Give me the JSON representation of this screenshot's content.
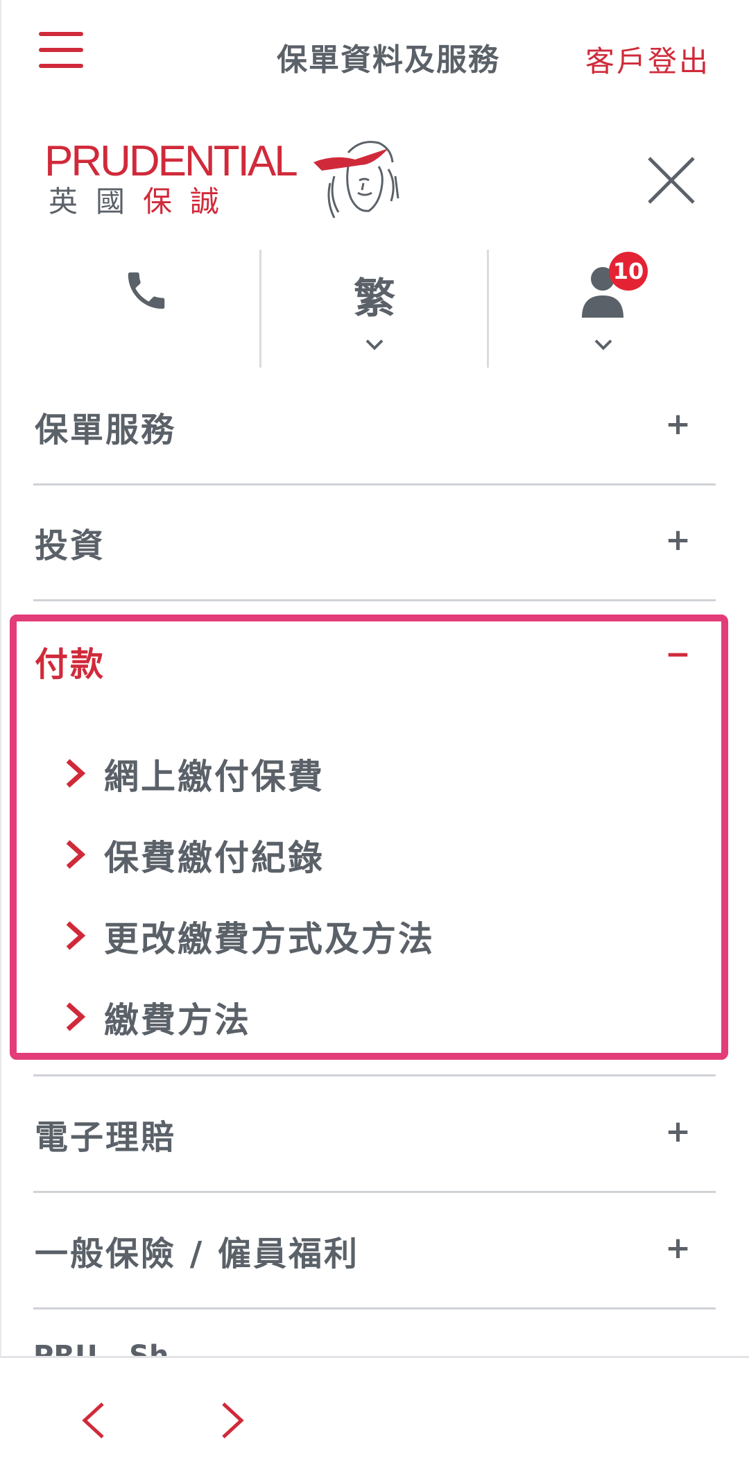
{
  "header": {
    "title": "保單資料及服務",
    "logout_label": "客戶登出"
  },
  "logo": {
    "brand_en": "PRUDENTIAL",
    "brand_cn_grey": "英國",
    "brand_cn_red": "保誠"
  },
  "utility": {
    "language_label": "繁",
    "notification_count": "10"
  },
  "menu": {
    "sections": [
      {
        "label": "保單服務",
        "toggle": "+"
      },
      {
        "label": "投資",
        "toggle": "+"
      },
      {
        "label": "付款",
        "toggle": "−"
      },
      {
        "label": "電子理賠",
        "toggle": "+"
      },
      {
        "label": "一般保險 / 僱員福利",
        "toggle": "+"
      }
    ],
    "payment_items": [
      {
        "label": "網上繳付保費"
      },
      {
        "label": "保費繳付紀錄"
      },
      {
        "label": "更改繳費方式及方法"
      },
      {
        "label": "繳費方法"
      }
    ],
    "peek_label": "PRU...Sh..."
  },
  "colors": {
    "brand_red": "#d02a3a",
    "text_grey": "#5b6168",
    "highlight_pink": "#e23d78",
    "badge_red": "#e32333"
  },
  "icons": [
    "hamburger-icon",
    "close-icon",
    "phone-icon",
    "chevron-down-icon",
    "user-icon",
    "chevron-right-icon",
    "chevron-left-icon"
  ]
}
